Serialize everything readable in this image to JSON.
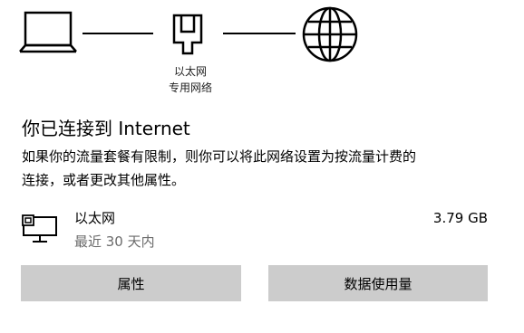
{
  "diagram": {
    "computer_icon": "laptop-icon",
    "adapter_icon": "ethernet-port-icon",
    "internet_icon": "globe-icon",
    "network_name": "以太网",
    "network_type": "专用网络"
  },
  "status": {
    "title": "你已连接到 Internet",
    "description_line1": "如果你的流量套餐有限制，则你可以将此网络设置为按流量计费的",
    "description_line2": "连接，或者更改其他属性。"
  },
  "adapter": {
    "icon": "ethernet-monitor-icon",
    "name": "以太网",
    "period": "最近 30 天内",
    "usage": "3.79 GB"
  },
  "buttons": {
    "properties_label": "属性",
    "data_usage_label": "数据使用量",
    "background": "#cccccc"
  }
}
